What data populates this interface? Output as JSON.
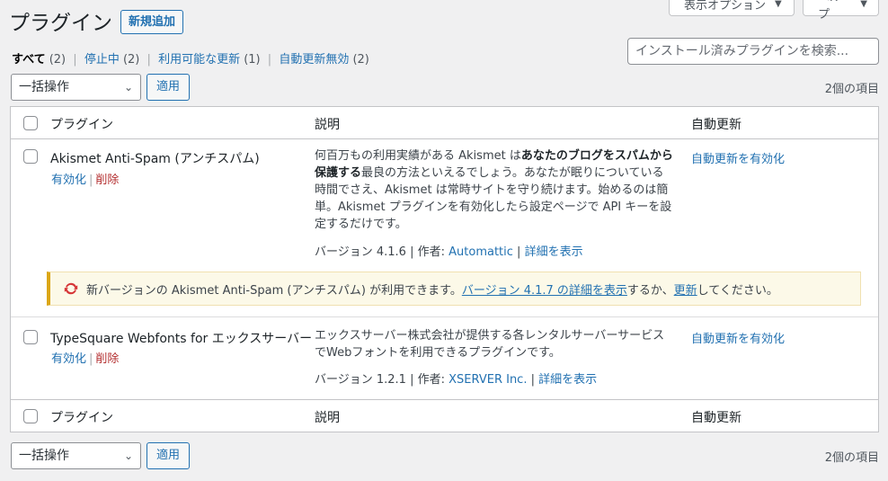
{
  "screen_options": {
    "display_options": "表示オプション",
    "help": "ヘルプ"
  },
  "page_title": "プラグイン",
  "add_new": "新規追加",
  "filters": {
    "all": "すべて",
    "all_count": "(2)",
    "inactive": "停止中",
    "inactive_count": "(2)",
    "updates": "利用可能な更新",
    "updates_count": "(1)",
    "auto_disabled": "自動更新無効",
    "auto_disabled_count": "(2)"
  },
  "search": {
    "placeholder": "インストール済みプラグインを検索..."
  },
  "bulk": {
    "select": "一括操作",
    "apply": "適用",
    "count": "2個の項目"
  },
  "table": {
    "col_plugin": "プラグイン",
    "col_desc": "説明",
    "col_auto": "自動更新"
  },
  "plugins": [
    {
      "name": "Akismet Anti-Spam (アンチスパム)",
      "activate": "有効化",
      "delete": "削除",
      "desc_1": "何百万もの利用実績がある Akismet は",
      "desc_bold": "あなたのブログをスパムから保護する",
      "desc_2": "最良の方法といえるでしょう。あなたが眠りについている時間でさえ、Akismet は常時サイトを守り続けます。始めるのは簡単。Akismet プラグインを有効化したら設定ページで API キーを設定するだけです。",
      "version": "バージョン 4.1.6",
      "author_label": "作者:",
      "author": "Automattic",
      "details": "詳細を表示",
      "auto_update": "自動更新を有効化"
    },
    {
      "name": "TypeSquare Webfonts for エックスサーバー",
      "activate": "有効化",
      "delete": "削除",
      "desc": "エックスサーバー株式会社が提供する各レンタルサーバーサービスでWebフォントを利用できるプラグインです。",
      "version": "バージョン 1.2.1",
      "author_label": "作者:",
      "author": "XSERVER Inc.",
      "details": "詳細を表示",
      "auto_update": "自動更新を有効化"
    }
  ],
  "update_notice": {
    "prefix": "新バージョンの Akismet Anti-Spam (アンチスパム) が利用できます。",
    "details_link": "バージョン 4.1.7 の詳細を表示",
    "middle": "するか、",
    "update_link": "更新",
    "suffix": "してください。"
  }
}
